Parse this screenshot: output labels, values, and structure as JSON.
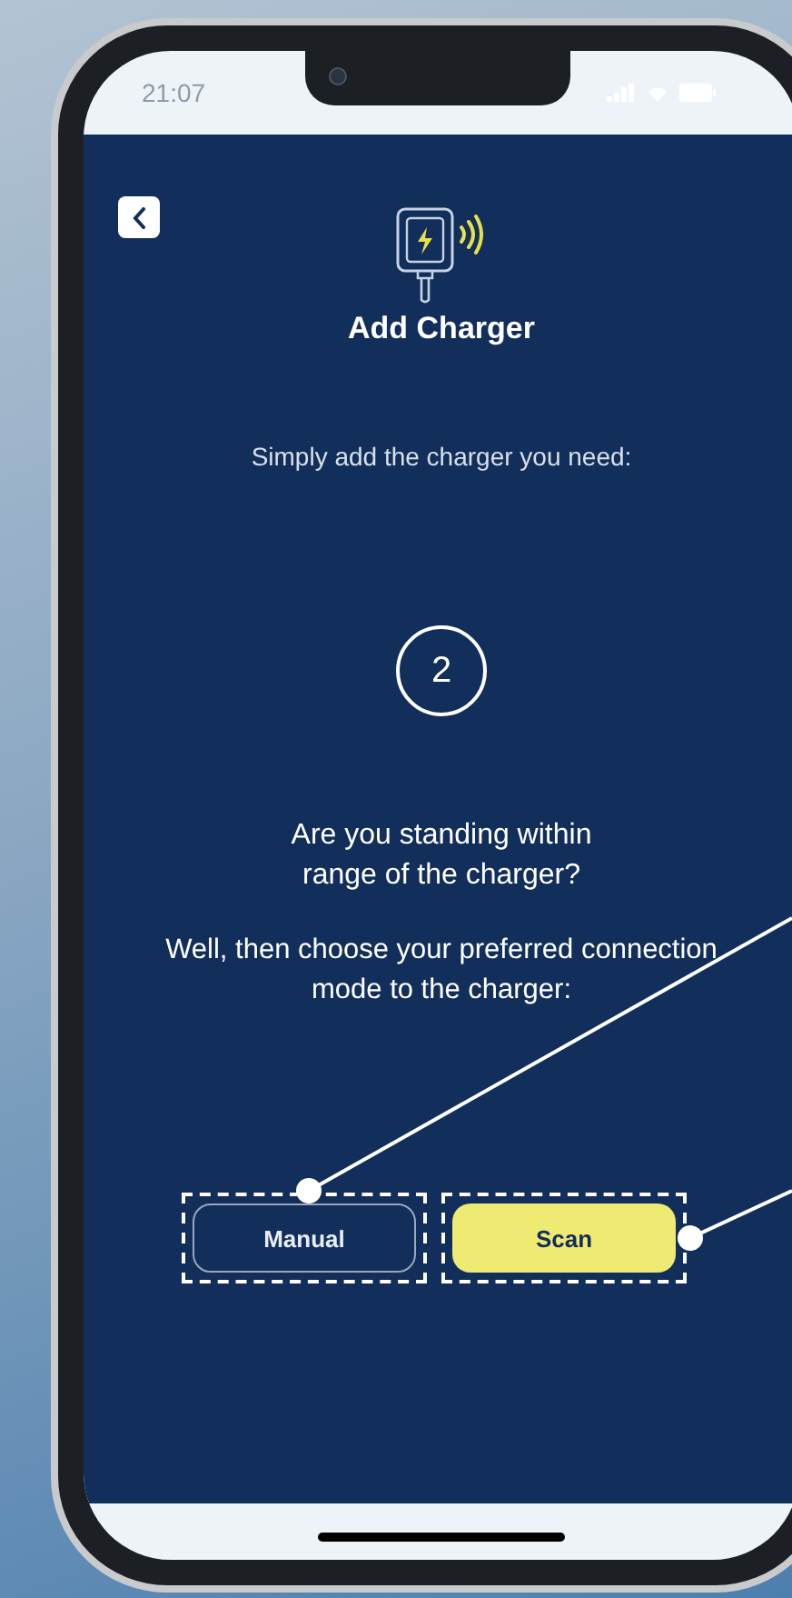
{
  "status_bar": {
    "time": "21:07"
  },
  "screen": {
    "title": "Add Charger",
    "subtitle": "Simply add the charger you need:",
    "step": "2",
    "question": "Are you standing within range of the charger?",
    "instruction": "Well, then choose your preferred connection mode to the charger:",
    "buttons": [
      {
        "label": "Manual",
        "kind": "outline",
        "highlighted": true
      },
      {
        "label": "Scan",
        "kind": "primary",
        "highlighted": true
      }
    ]
  }
}
